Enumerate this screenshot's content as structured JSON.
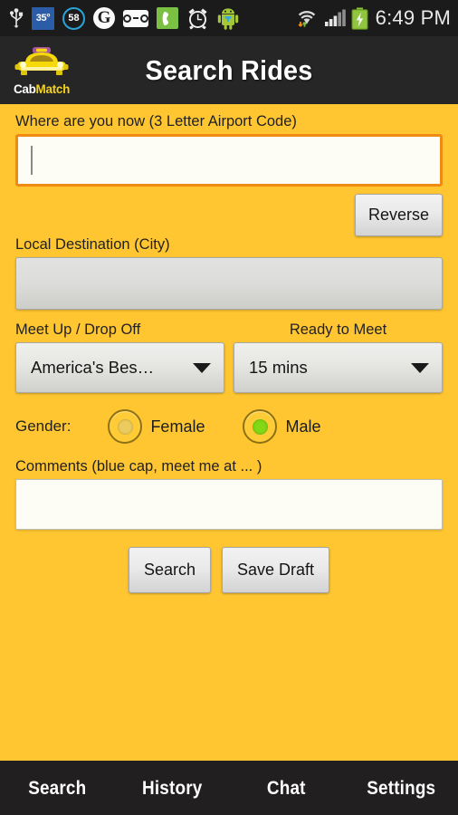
{
  "status_bar": {
    "time": "6:49 PM",
    "temperature": "35°",
    "notification_count": "58",
    "google_letter": "G",
    "icons": [
      "usb-icon",
      "weather-temp-icon",
      "notification-count-icon",
      "google-icon",
      "voicemail-icon",
      "phone-icon",
      "alarm-clock-icon",
      "android-robot-icon",
      "wifi-icon",
      "cellular-signal-icon",
      "battery-charging-icon"
    ]
  },
  "title_bar": {
    "app_title": "Search Rides",
    "logo": {
      "name": "cabmatch-logo",
      "text_part1": "Cab",
      "text_part2": "Match",
      "body_color": "#f5d90a",
      "roof_color": "#a6549d"
    }
  },
  "form": {
    "origin": {
      "label": "Where are you now (3 Letter Airport Code)",
      "value": "",
      "placeholder": "",
      "focused": true,
      "border_color": "#f08a12"
    },
    "reverse_button": "Reverse",
    "destination": {
      "label": "Local Destination (City)",
      "value": "",
      "placeholder": ""
    },
    "meetup": {
      "label": "Meet Up / Drop Off",
      "selected": "America's Bes…"
    },
    "ready": {
      "label": "Ready to Meet",
      "selected": "15 mins"
    },
    "gender": {
      "label": "Gender:",
      "options": [
        {
          "label": "Female",
          "selected": false
        },
        {
          "label": "Male",
          "selected": true
        }
      ],
      "selected_color": "#84d916"
    },
    "comments": {
      "label": "Comments (blue cap, meet me at ... )",
      "value": "",
      "placeholder": ""
    },
    "buttons": {
      "search": "Search",
      "save_draft": "Save Draft"
    }
  },
  "bottom_nav": {
    "items": [
      {
        "label": "Search"
      },
      {
        "label": "History"
      },
      {
        "label": "Chat"
      },
      {
        "label": "Settings"
      }
    ]
  },
  "colors": {
    "page_background": "#ffc631",
    "bar_background": "#1b1b1b",
    "title_background": "#262626",
    "nav_background": "#211f1f"
  }
}
